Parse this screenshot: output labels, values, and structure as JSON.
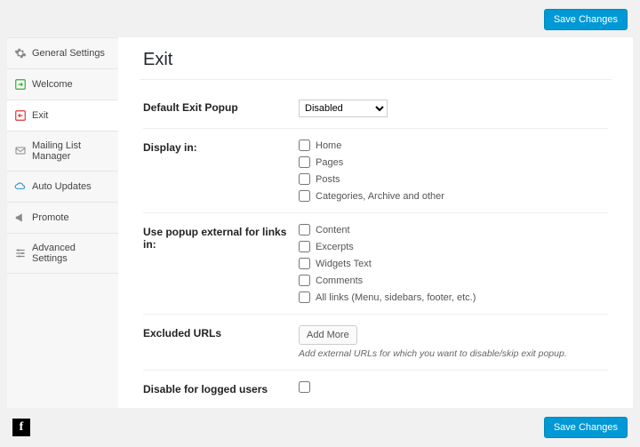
{
  "topbar": {
    "save_label": "Save Changes"
  },
  "sidebar": {
    "items": [
      {
        "label": "General Settings"
      },
      {
        "label": "Welcome"
      },
      {
        "label": "Exit"
      },
      {
        "label": "Mailing List Manager"
      },
      {
        "label": "Auto Updates"
      },
      {
        "label": "Promote"
      },
      {
        "label": "Advanced Settings"
      }
    ]
  },
  "main": {
    "title": "Exit",
    "rows": {
      "default_popup": {
        "label": "Default Exit Popup",
        "value": "Disabled"
      },
      "display_in": {
        "label": "Display in:",
        "options": [
          "Home",
          "Pages",
          "Posts",
          "Categories, Archive and other"
        ]
      },
      "external_links": {
        "label": "Use popup external for links in:",
        "options": [
          "Content",
          "Excerpts",
          "Widgets Text",
          "Comments",
          "All links (Menu, sidebars, footer, etc.)"
        ]
      },
      "excluded_urls": {
        "label": "Excluded URLs",
        "button": "Add More",
        "hint": "Add external URLs for which you want to disable/skip exit popup."
      },
      "disable_logged": {
        "label": "Disable for logged users"
      }
    }
  },
  "bottombar": {
    "save_label": "Save Changes"
  }
}
